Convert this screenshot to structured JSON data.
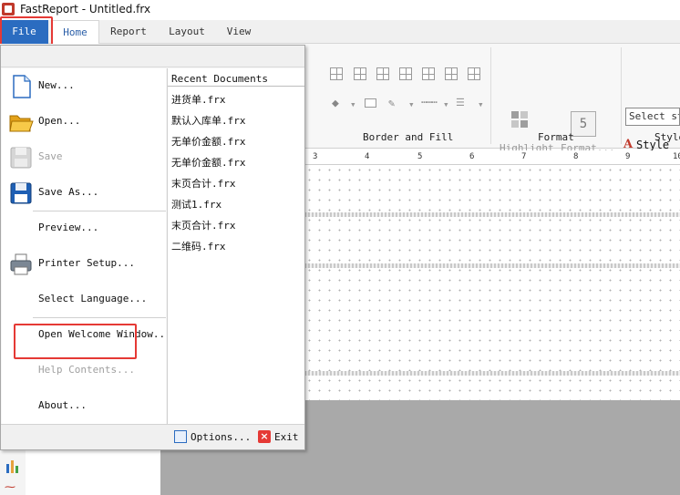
{
  "window": {
    "title": "FastReport - Untitled.frx"
  },
  "tabs": [
    {
      "label": "File"
    },
    {
      "label": "Home"
    },
    {
      "label": "Report"
    },
    {
      "label": "Layout"
    },
    {
      "label": "View"
    }
  ],
  "ribbon": {
    "groups": [
      {
        "label": "Border and Fill"
      },
      {
        "label": "Format"
      },
      {
        "label": "Style"
      }
    ],
    "highlight_label": "Highlight",
    "format_label": "Format...",
    "style_select_placeholder": "Select sty",
    "styles_label": "Style"
  },
  "ruler": {
    "numbers": [
      "3",
      "4",
      "5",
      "6",
      "7",
      "8",
      "9",
      "10"
    ]
  },
  "file_menu": {
    "items": [
      {
        "label": "New...",
        "icon": "new-document-icon",
        "enabled": true
      },
      {
        "label": "Open...",
        "icon": "open-folder-icon",
        "enabled": true
      },
      {
        "label": "Save",
        "icon": "save-disk-icon",
        "enabled": false
      },
      {
        "label": "Save As...",
        "icon": "save-as-disk-icon",
        "enabled": true
      },
      {
        "label": "Preview...",
        "icon": "",
        "enabled": true
      },
      {
        "label": "Printer Setup...",
        "icon": "printer-icon",
        "enabled": true
      },
      {
        "label": "Select Language...",
        "icon": "",
        "enabled": true
      },
      {
        "label": "Open Welcome Window...",
        "icon": "",
        "enabled": true
      },
      {
        "label": "Help Contents...",
        "icon": "",
        "enabled": false
      },
      {
        "label": "About...",
        "icon": "",
        "enabled": true
      }
    ],
    "recent_header": "Recent Documents",
    "recent": [
      "进货单.frx",
      "默认入库单.frx",
      "无单价金额.frx",
      "无单价金额.frx",
      "末页合计.frx",
      "测试1.frx",
      "末页合计.frx",
      "二维码.frx"
    ],
    "options_label": "Options...",
    "exit_label": "Exit"
  },
  "colors": {
    "file_tab": "#2b6cc0",
    "highlight_box": "#e53935"
  }
}
